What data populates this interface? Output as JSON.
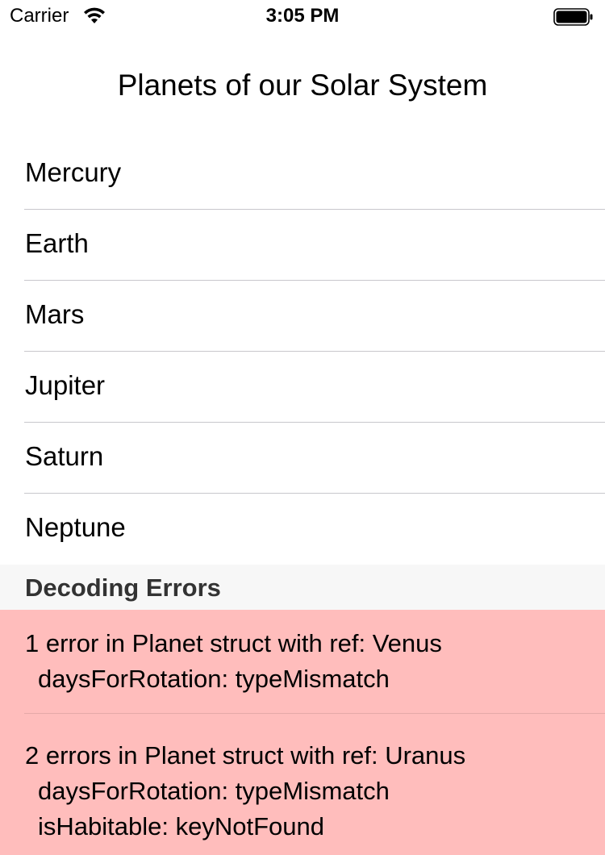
{
  "status_bar": {
    "carrier": "Carrier",
    "time": "3:05 PM",
    "wifi_icon": "wifi-icon",
    "battery_icon": "battery-icon"
  },
  "title": "Planets of our Solar System",
  "planets": [
    {
      "name": "Mercury"
    },
    {
      "name": "Earth"
    },
    {
      "name": "Mars"
    },
    {
      "name": "Jupiter"
    },
    {
      "name": "Saturn"
    },
    {
      "name": "Neptune"
    }
  ],
  "errors_section": {
    "header": "Decoding Errors",
    "background_color": "#ffbdbc",
    "items": [
      {
        "summary": "1 error in Planet struct with ref: Venus",
        "details": [
          "daysForRotation: typeMismatch"
        ]
      },
      {
        "summary": "2 errors in Planet struct with ref: Uranus",
        "details": [
          "daysForRotation: typeMismatch",
          "isHabitable: keyNotFound"
        ]
      }
    ]
  }
}
